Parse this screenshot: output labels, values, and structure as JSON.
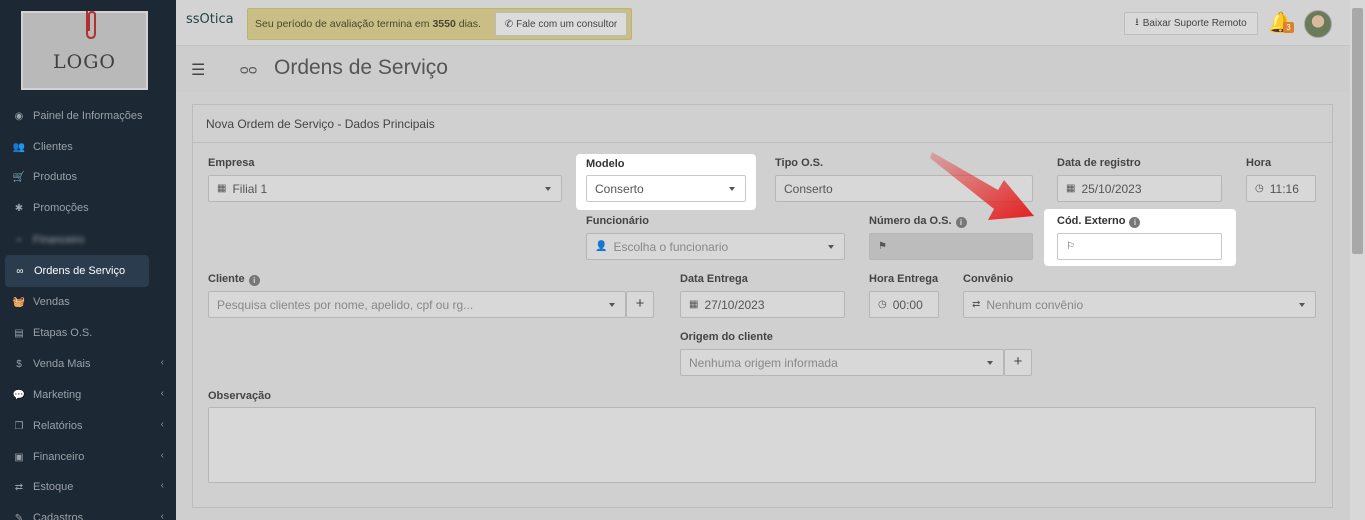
{
  "sidebar": {
    "logo_text": "LOGO",
    "items": [
      {
        "label": "Painel de Informações",
        "icon": "dashboard-icon"
      },
      {
        "label": "Clientes",
        "icon": "users-icon"
      },
      {
        "label": "Produtos",
        "icon": "cart-icon"
      },
      {
        "label": "Promoções",
        "icon": "asterisk-icon"
      },
      {
        "label": "Financeiro",
        "icon": "blurred-icon"
      },
      {
        "label": "Ordens de Serviço",
        "icon": "glasses-icon"
      },
      {
        "label": "Vendas",
        "icon": "basket-icon"
      },
      {
        "label": "Etapas O.S.",
        "icon": "steps-icon"
      },
      {
        "label": "Venda Mais",
        "icon": "dollar-icon"
      },
      {
        "label": "Marketing",
        "icon": "comments-icon"
      },
      {
        "label": "Relatórios",
        "icon": "report-icon"
      },
      {
        "label": "Financeiro",
        "icon": "money-icon"
      },
      {
        "label": "Estoque",
        "icon": "exchange-icon"
      },
      {
        "label": "Cadastros",
        "icon": "edit-icon"
      }
    ]
  },
  "topbar": {
    "brand": "ssOtica",
    "trial_prefix": "Seu período de avaliação termina em ",
    "trial_days": "3550",
    "trial_suffix": " dias.",
    "consult_label": "Fale com um consultor",
    "download_label": "Baixar Suporte Remoto",
    "notification_count": "3"
  },
  "page": {
    "title": "Ordens de Serviço"
  },
  "form": {
    "panel_title": "Nova Ordem de Serviço - Dados Principais",
    "empresa": {
      "label": "Empresa",
      "value": "Filial 1"
    },
    "modelo": {
      "label": "Modelo",
      "value": "Conserto"
    },
    "tipo_os": {
      "label": "Tipo O.S.",
      "value": "Conserto"
    },
    "data_registro": {
      "label": "Data de registro",
      "value": "25/10/2023"
    },
    "hora": {
      "label": "Hora",
      "value": "11:16"
    },
    "funcionario": {
      "label": "Funcionário",
      "placeholder": "Escolha o funcionario"
    },
    "numero_os": {
      "label": "Número da O.S.",
      "value": ""
    },
    "cod_externo": {
      "label": "Cód. Externo",
      "value": ""
    },
    "cliente": {
      "label": "Cliente",
      "placeholder": "Pesquisa clientes por nome, apelido, cpf ou rg..."
    },
    "data_entrega": {
      "label": "Data Entrega",
      "value": "27/10/2023"
    },
    "hora_entrega": {
      "label": "Hora Entrega",
      "value": "00:00"
    },
    "convenio": {
      "label": "Convênio",
      "value": "Nenhum convênio"
    },
    "origem": {
      "label": "Origem do cliente",
      "value": "Nenhuma origem informada"
    },
    "observacao": {
      "label": "Observação",
      "value": ""
    }
  },
  "colors": {
    "sidebar_bg": "#1c2834",
    "highlight": "#ffffff",
    "arrow": "#e41e1e",
    "trial_bg": "#c9bf86"
  }
}
